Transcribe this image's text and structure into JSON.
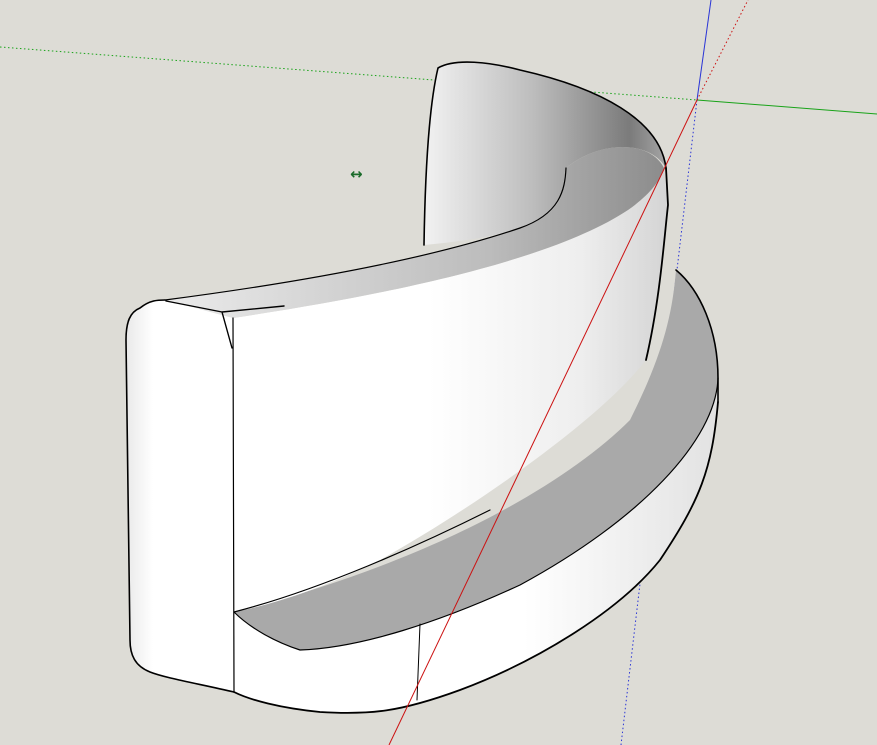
{
  "viewport": {
    "background_color": "#dddcd6",
    "axis_colors": {
      "red": "#cc1111",
      "green": "#19a319",
      "blue": "#2a35d6"
    }
  },
  "model": {
    "name": "curved-wall-on-base",
    "face_color": "#ffffff",
    "edge_color": "#000000",
    "shadow_color": "#a9a9a9"
  },
  "cursor": {
    "icon": "move-horizontal-arrow-icon",
    "glyph": "↔",
    "color": "#1a6b2a"
  }
}
